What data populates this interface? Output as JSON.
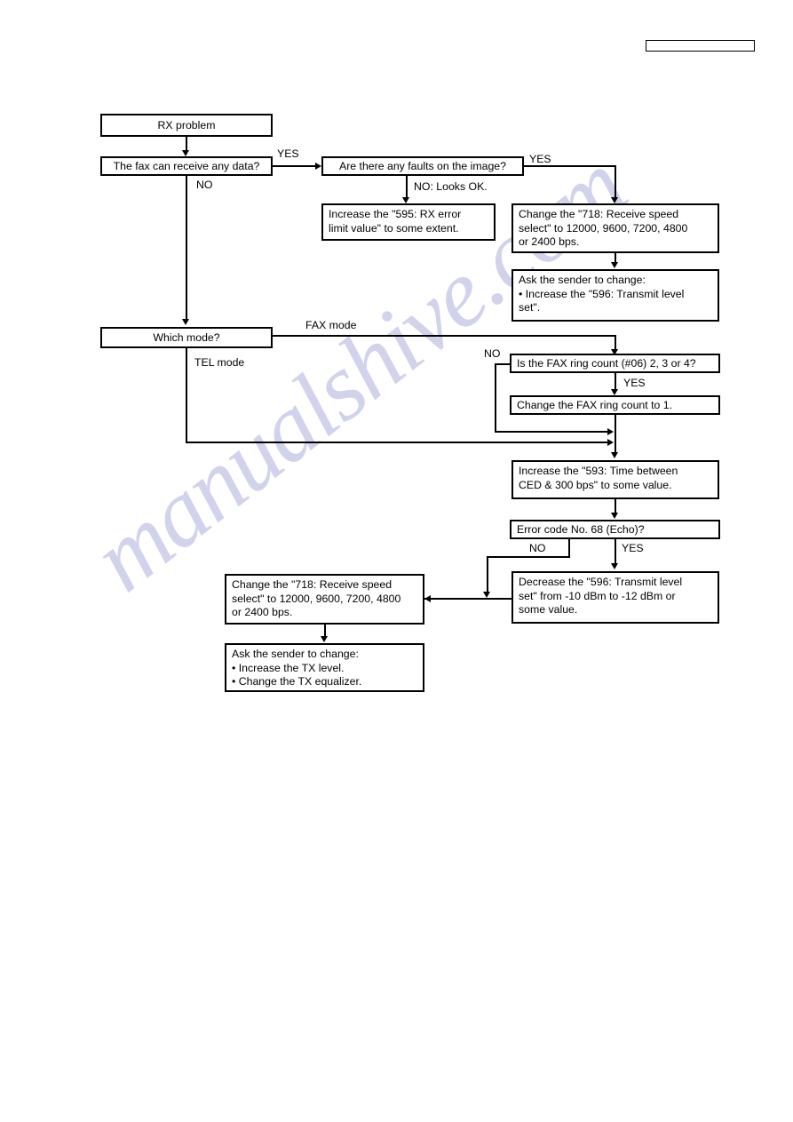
{
  "document": {
    "watermark": "manualshive.com",
    "header_box_label": ""
  },
  "chart_data": {
    "type": "diagram",
    "title": "RX problem troubleshooting flowchart",
    "nodes": [
      {
        "id": "rx-problem",
        "label": "RX problem"
      },
      {
        "id": "can-receive",
        "label": "The fax can receive any data?"
      },
      {
        "id": "faults-on-image",
        "label": "Are there any faults on the image?"
      },
      {
        "id": "increase-595",
        "label": "Increase the \"595: RX error\nlimit value\" to some extent."
      },
      {
        "id": "change-718-top",
        "label": "Change the \"718: Receive speed\nselect\" to 12000, 9600, 7200, 4800\nor 2400 bps."
      },
      {
        "id": "ask-sender-596",
        "label": "Ask the sender to change:\n• Increase the \"596: Transmit level\nset\"."
      },
      {
        "id": "which-mode",
        "label": "Which mode?"
      },
      {
        "id": "ring-count-q",
        "label": "Is the FAX ring count (#06) 2, 3 or 4?"
      },
      {
        "id": "change-ring-count",
        "label": "Change the FAX ring count to 1."
      },
      {
        "id": "increase-593",
        "label": "Increase the \"593: Time between\nCED & 300 bps\" to some value."
      },
      {
        "id": "error-code-68",
        "label": "Error code No. 68 (Echo)?"
      },
      {
        "id": "decrease-596",
        "label": "Decrease the \"596: Transmit level\nset\" from -10 dBm to -12 dBm or\nsome value."
      },
      {
        "id": "change-718-bottom",
        "label": "Change the \"718: Receive speed\nselect\" to 12000, 9600, 7200, 4800\nor 2400 bps."
      },
      {
        "id": "ask-sender-tx",
        "label": "Ask the sender to change:\n• Increase the TX level.\n• Change the TX equalizer."
      }
    ],
    "edge_labels": {
      "can_receive_yes": "YES",
      "can_receive_no": "NO",
      "faults_yes": "YES",
      "faults_no": "NO: Looks OK.",
      "mode_fax": "FAX mode",
      "mode_tel": "TEL mode",
      "ring_count_no": "NO",
      "ring_count_yes": "YES",
      "error_no": "NO",
      "error_yes": "YES"
    },
    "edges": [
      {
        "from": "rx-problem",
        "to": "can-receive",
        "label": ""
      },
      {
        "from": "can-receive",
        "to": "faults-on-image",
        "label": "YES"
      },
      {
        "from": "can-receive",
        "to": "which-mode",
        "label": "NO"
      },
      {
        "from": "faults-on-image",
        "to": "increase-595",
        "label": "NO: Looks OK."
      },
      {
        "from": "faults-on-image",
        "to": "change-718-top",
        "label": "YES"
      },
      {
        "from": "change-718-top",
        "to": "ask-sender-596",
        "label": ""
      },
      {
        "from": "which-mode",
        "to": "ring-count-q",
        "label": "FAX mode"
      },
      {
        "from": "which-mode",
        "to": "increase-593",
        "label": "TEL mode"
      },
      {
        "from": "ring-count-q",
        "to": "change-ring-count",
        "label": "YES"
      },
      {
        "from": "ring-count-q",
        "to": "increase-593",
        "label": "NO"
      },
      {
        "from": "change-ring-count",
        "to": "increase-593",
        "label": ""
      },
      {
        "from": "increase-593",
        "to": "error-code-68",
        "label": ""
      },
      {
        "from": "error-code-68",
        "to": "decrease-596",
        "label": "YES"
      },
      {
        "from": "error-code-68",
        "to": "change-718-bottom",
        "label": "NO"
      },
      {
        "from": "decrease-596",
        "to": "change-718-bottom",
        "label": ""
      },
      {
        "from": "change-718-bottom",
        "to": "ask-sender-tx",
        "label": ""
      }
    ]
  }
}
